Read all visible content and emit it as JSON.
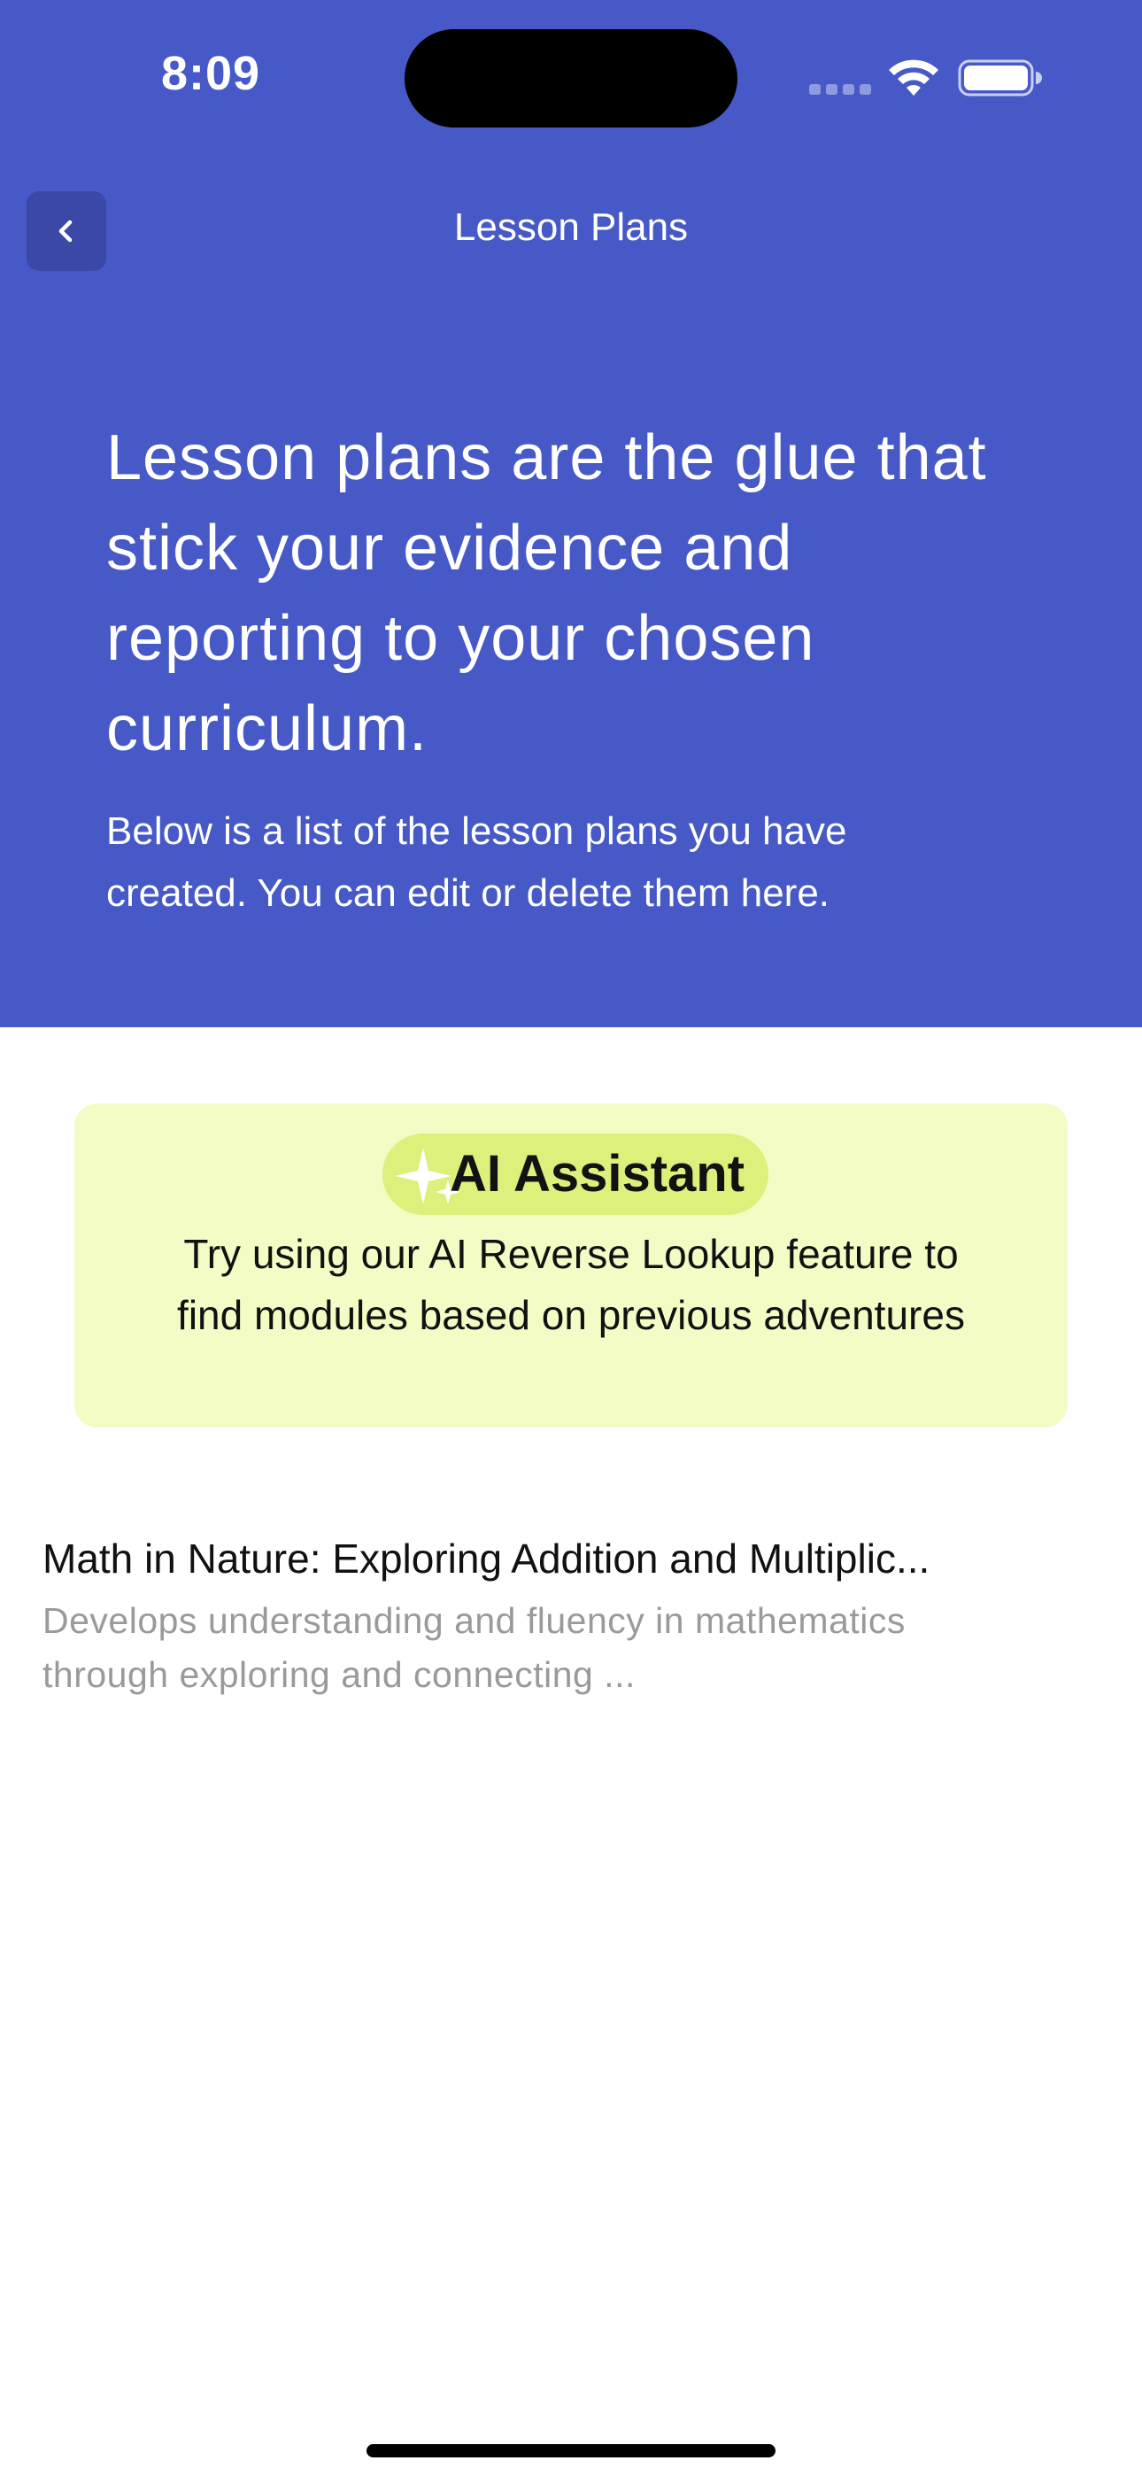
{
  "status_bar": {
    "time": "8:09"
  },
  "nav": {
    "title": "Lesson Plans",
    "back_icon": "chevron-left-icon"
  },
  "hero": {
    "heading": "Lesson plans are the glue that stick your evidence and reporting to your chosen curriculum.",
    "subtext": "Below is a list of the lesson plans you have created. You can edit or delete them here."
  },
  "ai_card": {
    "icon": "sparkles-icon",
    "label": "AI Assistant",
    "description": "Try using our AI Reverse Lookup feature to find modules based on previous adventures"
  },
  "lessons": [
    {
      "title": "Math in Nature: Exploring Addition and Multiplic...",
      "description": "Develops understanding and fluency in mathematics through exploring and connecting ..."
    }
  ],
  "colors": {
    "primary": "#4659C7",
    "back_button": "#3B48A6",
    "ai_card_bg": "#F3FCC4",
    "ai_pill_bg": "#DCF07B",
    "muted_text": "#9A9A9A"
  }
}
